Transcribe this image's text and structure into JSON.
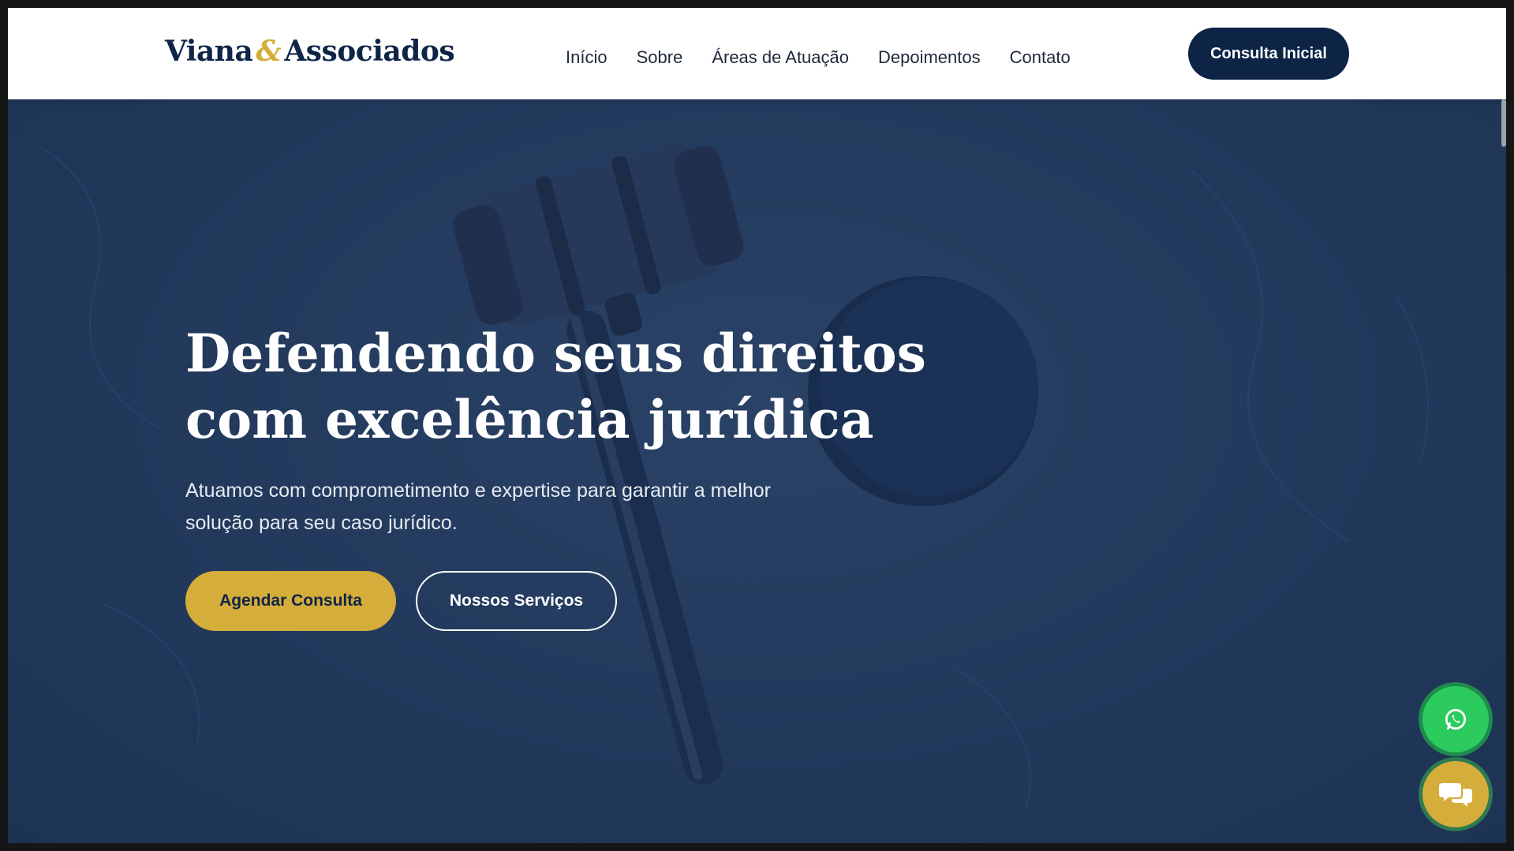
{
  "brand": {
    "name_part1": "Viana",
    "ampersand": "&",
    "name_part2": "Associados",
    "primary_color": "#0d2447",
    "accent_color": "#d4ad3a"
  },
  "nav": {
    "items": [
      {
        "label": "Início"
      },
      {
        "label": "Sobre"
      },
      {
        "label": "Áreas de Atuação"
      },
      {
        "label": "Depoimentos"
      },
      {
        "label": "Contato"
      }
    ],
    "cta_label": "Consulta Inicial"
  },
  "hero": {
    "title_line1": "Defendendo seus direitos",
    "title_line2": "com excelência jurídica",
    "subtitle_line1": "Atuamos com comprometimento e expertise para garantir a melhor",
    "subtitle_line2": "solução para seu caso jurídico.",
    "primary_button": "Agendar Consulta",
    "secondary_button": "Nossos Serviços",
    "background_image": "gavel-image"
  },
  "floating": {
    "whatsapp_icon": "whatsapp-icon",
    "whatsapp_color": "#2bcb5e",
    "chat_icon": "chat-bubbles-icon",
    "chat_color": "#d4ad3a"
  }
}
